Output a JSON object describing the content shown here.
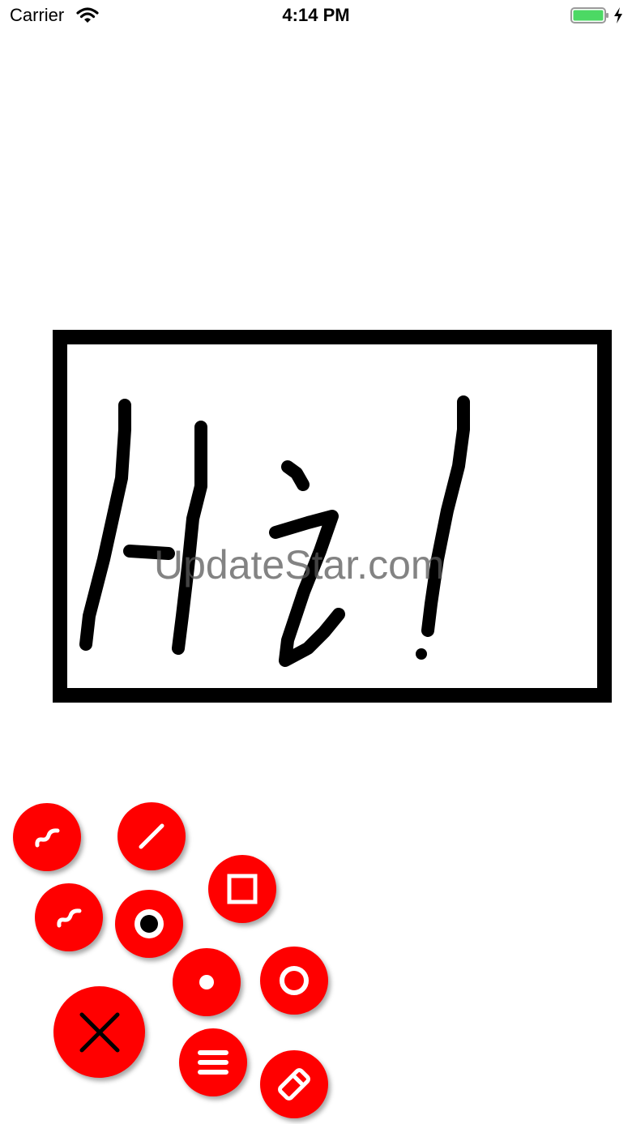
{
  "status_bar": {
    "carrier": "Carrier",
    "time": "4:14 PM",
    "battery_color": "#4cd964"
  },
  "watermark": "UpdateStar.com",
  "colors": {
    "accent": "#ff0000",
    "ink": "#000000",
    "icon": "#ffffff"
  },
  "toolbar": {
    "buttons": [
      {
        "name": "freehand-tool",
        "icon": "squiggle-icon"
      },
      {
        "name": "line-tool",
        "icon": "line-icon"
      },
      {
        "name": "rectangle-tool",
        "icon": "square-icon"
      },
      {
        "name": "freehand-tool-2",
        "icon": "squiggle-icon"
      },
      {
        "name": "stroke-large",
        "icon": "large-dot-icon"
      },
      {
        "name": "stroke-small",
        "icon": "small-dot-icon"
      },
      {
        "name": "ellipse-tool",
        "icon": "circle-outline-icon"
      },
      {
        "name": "close-menu",
        "icon": "close-icon"
      },
      {
        "name": "menu",
        "icon": "menu-icon"
      },
      {
        "name": "eraser-tool",
        "icon": "eraser-icon"
      }
    ]
  }
}
